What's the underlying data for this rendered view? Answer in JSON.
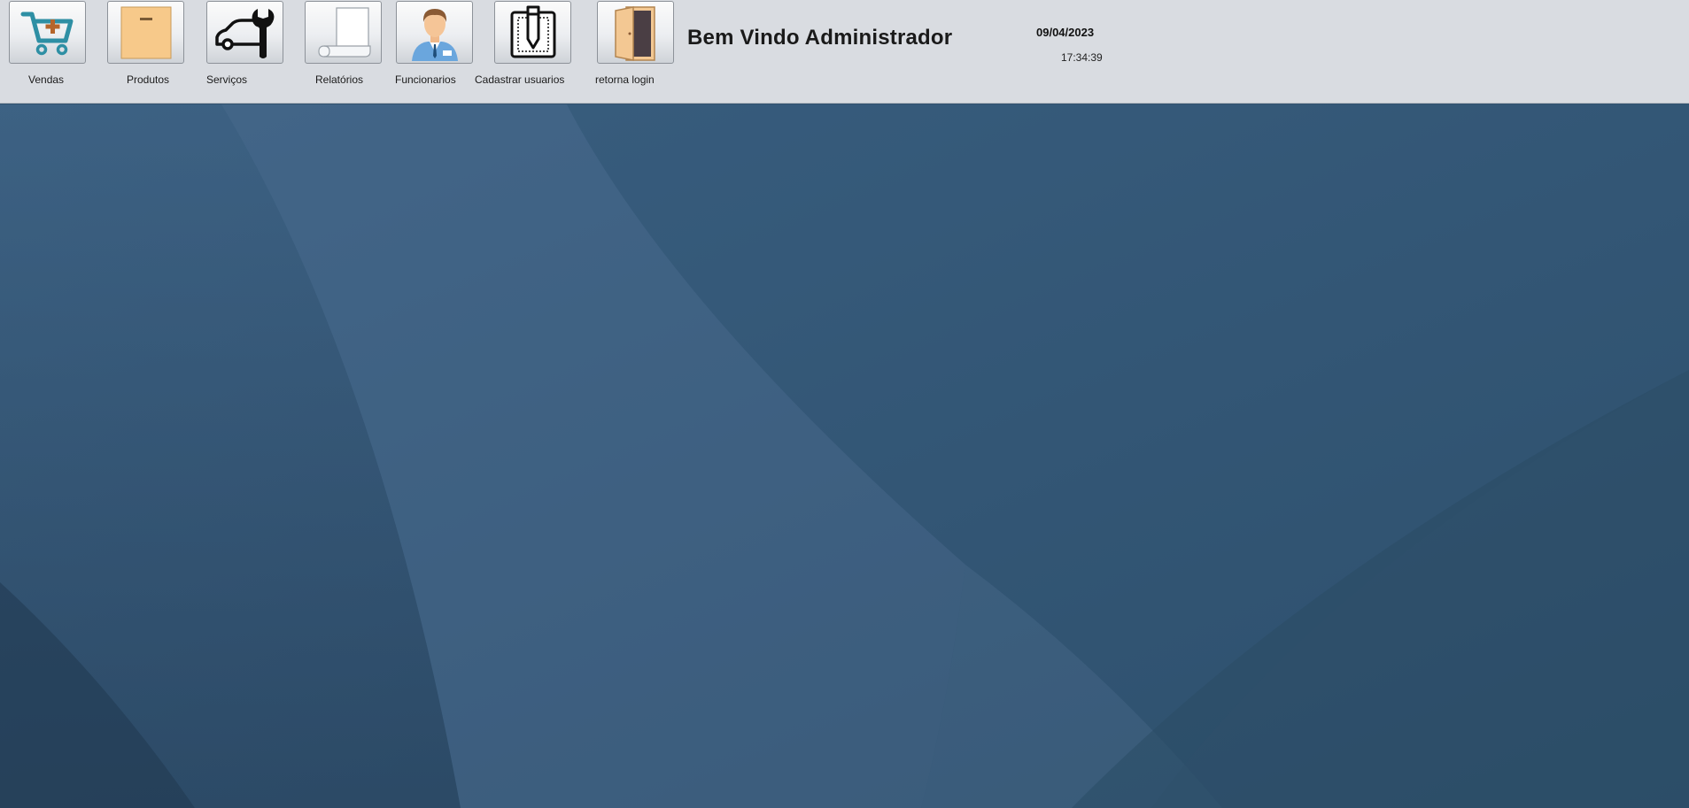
{
  "toolbar": {
    "buttons": [
      {
        "label": "Vendas",
        "icon": "shopping-cart-add-icon"
      },
      {
        "label": "Produtos",
        "icon": "product-box-icon"
      },
      {
        "label": "Serviços",
        "icon": "car-wrench-icon"
      },
      {
        "label": "Relatórios",
        "icon": "report-scroll-icon"
      },
      {
        "label": "Funcionarios",
        "icon": "employee-icon"
      },
      {
        "label": "Cadastrar usuarios",
        "icon": "register-pencil-icon"
      },
      {
        "label": "retorna login",
        "icon": "exit-door-icon"
      }
    ]
  },
  "header": {
    "welcome": "Bem Vindo Administrador",
    "date": "09/04/2023",
    "time": "17:34:39"
  },
  "colors": {
    "toolbar_bg": "#d9dce1",
    "desktop_bg": "#33536f",
    "cart_teal": "#2e8fa4",
    "box_orange": "#f7c98a"
  }
}
